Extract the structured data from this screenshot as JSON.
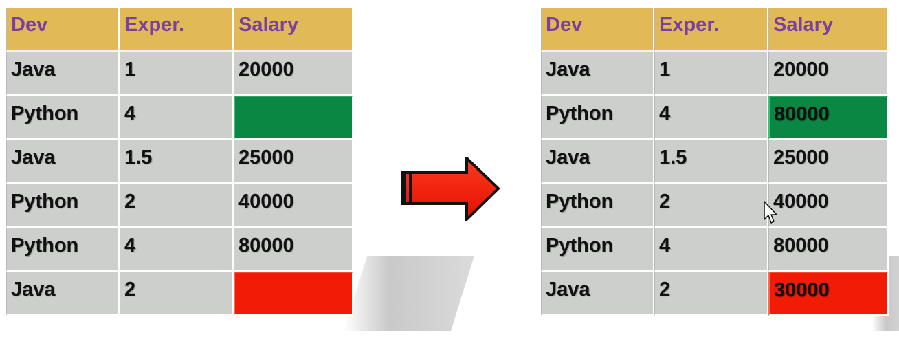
{
  "columns": [
    "Dev",
    "Exper.",
    "Salary"
  ],
  "before": {
    "rows": [
      {
        "dev": "Java",
        "exp": "1",
        "salary": "20000",
        "highlight": ""
      },
      {
        "dev": "Python",
        "exp": "4",
        "salary": "",
        "highlight": "green"
      },
      {
        "dev": "Java",
        "exp": "1.5",
        "salary": "25000",
        "highlight": ""
      },
      {
        "dev": "Python",
        "exp": "2",
        "salary": "40000",
        "highlight": ""
      },
      {
        "dev": "Python",
        "exp": "4",
        "salary": "80000",
        "highlight": ""
      },
      {
        "dev": "Java",
        "exp": "2",
        "salary": "",
        "highlight": "red"
      }
    ]
  },
  "after": {
    "rows": [
      {
        "dev": "Java",
        "exp": "1",
        "salary": "20000",
        "highlight": ""
      },
      {
        "dev": "Python",
        "exp": "4",
        "salary": "80000",
        "highlight": "green"
      },
      {
        "dev": "Java",
        "exp": "1.5",
        "salary": "25000",
        "highlight": ""
      },
      {
        "dev": "Python",
        "exp": "2",
        "salary": "40000",
        "highlight": ""
      },
      {
        "dev": "Python",
        "exp": "4",
        "salary": "80000",
        "highlight": ""
      },
      {
        "dev": "Java",
        "exp": "2",
        "salary": "30000",
        "highlight": "red"
      }
    ]
  },
  "colors": {
    "header_bg": "#e2b957",
    "header_text": "#7a3fa0",
    "cell_bg": "#cdcfcd",
    "highlight_green": "#0a8742",
    "highlight_red": "#f21b05",
    "arrow": "#f21b05"
  },
  "icons": {
    "arrow": "right-arrow-icon",
    "cursor": "mouse-pointer-icon"
  }
}
